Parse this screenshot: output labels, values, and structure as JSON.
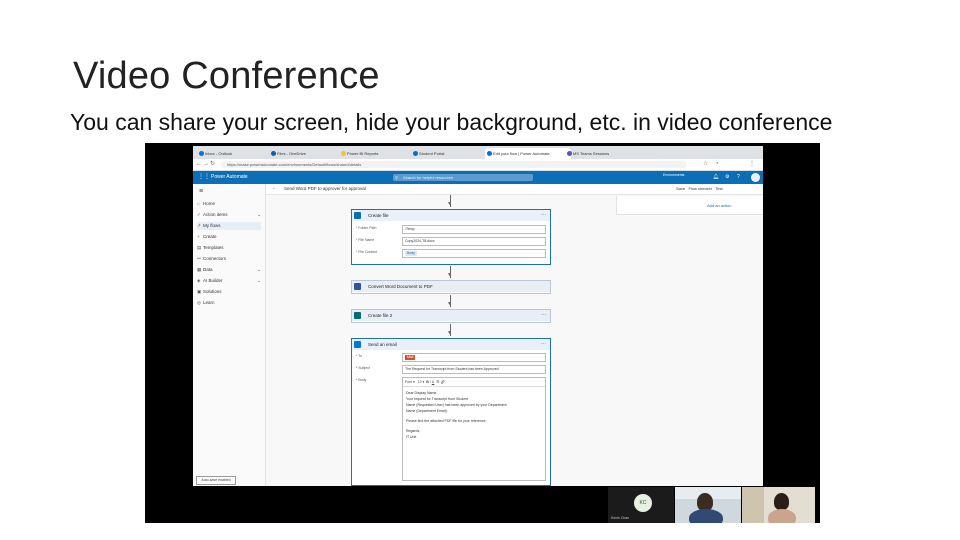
{
  "slide": {
    "title": "Video Conference",
    "subtitle": "You can share your screen, hide your background, etc. in video conference"
  },
  "browser": {
    "tabs": [
      {
        "label": "Inbox - Outlook",
        "color": "#0078d4"
      },
      {
        "label": "Files - OneDrive",
        "color": "#0364b8"
      },
      {
        "label": "Power BI Reports",
        "color": "#f2c811"
      },
      {
        "label": "Student Portal",
        "color": "#0b6fb8"
      },
      {
        "label": "Edit your flow | Power Automate",
        "color": "#0066ff"
      },
      {
        "label": "MS Teams Sessions",
        "color": "#5558af"
      }
    ],
    "url": "https://make.powerautomate.com/environments/Default/flows/shared/details"
  },
  "app": {
    "title": "Power Automate",
    "search_placeholder": "Search for helpful resources",
    "environment": "Environments",
    "nav": [
      {
        "label": "Home",
        "icon": "⌂"
      },
      {
        "label": "Action items",
        "icon": "✓"
      },
      {
        "label": "My flows",
        "icon": "↗"
      },
      {
        "label": "Create",
        "icon": "+"
      },
      {
        "label": "Templates",
        "icon": "▤"
      },
      {
        "label": "Connectors",
        "icon": "⚯"
      },
      {
        "label": "Data",
        "icon": "▦"
      },
      {
        "label": "AI Builder",
        "icon": "◈"
      },
      {
        "label": "Solutions",
        "icon": "▣"
      },
      {
        "label": "Learn",
        "icon": "◎"
      }
    ],
    "status_text": "Auto-save enabled",
    "flow_name": "Send Word PDF to approver for approval",
    "commands": {
      "save": "Save",
      "checker": "Flow checker",
      "test": "Test"
    },
    "right_panel_link": "Add an action"
  },
  "flow": {
    "create_file": {
      "title": "Create file",
      "fields": [
        {
          "label": "* Folder Path",
          "value": "/Temp"
        },
        {
          "label": "* File Name",
          "value": "Copy2024-T8.docx"
        },
        {
          "label": "* File Content",
          "value": "Body"
        }
      ]
    },
    "convert_step": "Convert Word Document to PDF",
    "create_file2": "Create file 2",
    "email": {
      "title": "Send an email",
      "to_label": "* To",
      "to_value": "Mail",
      "subject_label": "* Subject",
      "subject_value": "The Request for Transcript from Student has been Approved",
      "body_label": "* Body",
      "font": "Font",
      "font_size": "12",
      "body_lines": [
        "Dear Display Name,",
        "Your request for Transcript from Student",
        "Name (Requested User) has been approved by your Department",
        "Name (Department Email).",
        "Please find the attached PDF file for your reference.",
        "Regards,",
        "IT Unit"
      ]
    }
  },
  "video": {
    "participant_initials": "KC",
    "participant_name": "Kevin Chan"
  }
}
